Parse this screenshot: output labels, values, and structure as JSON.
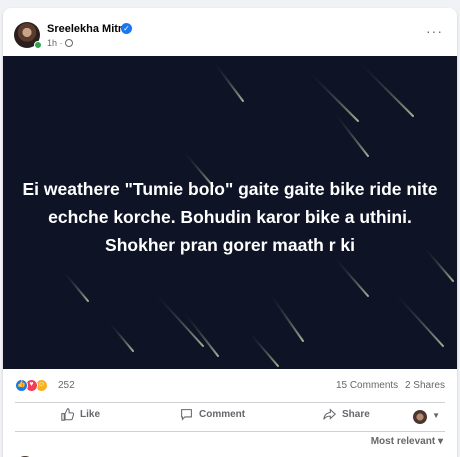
{
  "post": {
    "author": "Sreelekha Mitra",
    "time": "1h",
    "more_label": "···",
    "text": "Ei weathere \"Tumie bolo\" gaite gaite bike ride nite echche korche. Bohudin karor bike a uthini. Shokher pran gorer maath r ki",
    "background_color": "#0e1426"
  },
  "stats": {
    "reaction_count": "252",
    "comments": "15 Comments",
    "shares": "2 Shares"
  },
  "actions": {
    "like_label": "Like",
    "comment_label": "Comment",
    "share_label": "Share"
  },
  "comments": {
    "sort_label": "Most relevant"
  },
  "icons": [
    "verified-icon",
    "globe-icon",
    "more-icon",
    "like-reaction-icon",
    "love-reaction-icon",
    "haha-reaction-icon",
    "like-icon",
    "comment-icon",
    "share-icon",
    "chevron-down-icon"
  ],
  "colors": {
    "accent": "#1877f2",
    "love": "#f33e58",
    "haha": "#f7b125",
    "online": "#31a24c"
  }
}
